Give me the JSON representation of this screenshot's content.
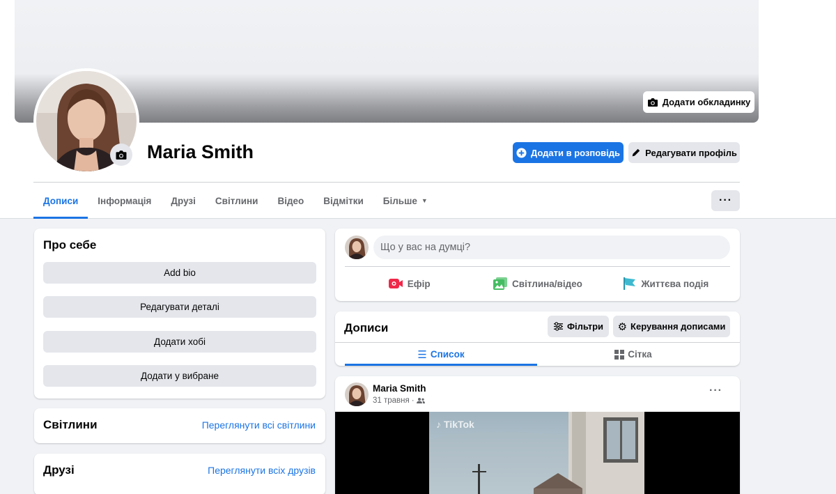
{
  "profile": {
    "name": "Maria Smith",
    "add_cover_label": "Додати обкладинку",
    "add_story_label": "Додати в розповідь",
    "edit_profile_label": "Редагувати профіль"
  },
  "tabs": [
    {
      "label": "Дописи",
      "active": true
    },
    {
      "label": "Інформація"
    },
    {
      "label": "Друзі"
    },
    {
      "label": "Світлини"
    },
    {
      "label": "Відео"
    },
    {
      "label": "Відмітки"
    },
    {
      "label": "Більше"
    }
  ],
  "about": {
    "title": "Про себе",
    "buttons": [
      "Add bio",
      "Редагувати деталі",
      "Додати хобі",
      "Додати у вибране"
    ]
  },
  "photos": {
    "title": "Світлини",
    "link": "Переглянути всі світлини"
  },
  "friends": {
    "title": "Друзі",
    "link": "Переглянути всіх друзів"
  },
  "composer": {
    "placeholder": "Що у вас на думці?",
    "actions": [
      "Ефір",
      "Світлина/відео",
      "Життєва подія"
    ]
  },
  "posts_header": {
    "title": "Дописи",
    "filters_label": "Фільтри",
    "manage_label": "Керування дописами",
    "view_list_label": "Список",
    "view_grid_label": "Сітка"
  },
  "post": {
    "author": "Maria Smith",
    "date": "31 травня",
    "watermark": "TikTok"
  },
  "colors": {
    "accent": "#1b74e4",
    "live": "#f02849",
    "photo": "#45bd62",
    "event": "#3eb9d0"
  }
}
